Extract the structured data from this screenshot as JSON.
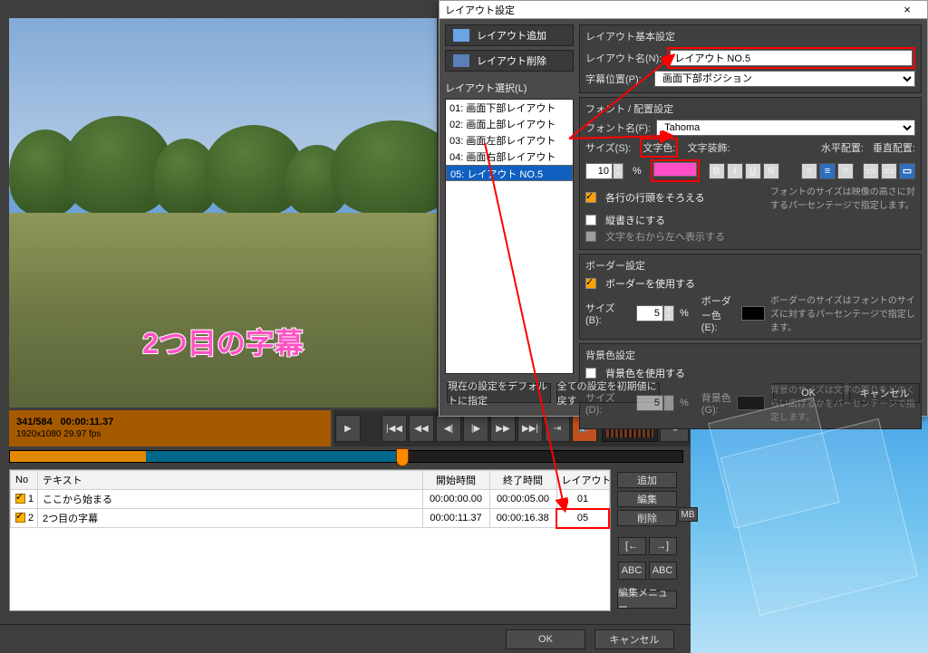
{
  "preview": {
    "subtitle_text": "2つ目の字幕"
  },
  "counter": {
    "frames": "341/584",
    "timecode": "00:00:11.37",
    "meta": "1920x1080 29.97 fps"
  },
  "transport": {
    "play": "▶",
    "prev2": "|◀◀",
    "prev1": "◀◀",
    "step_back": "◀|",
    "step_fwd": "|▶",
    "next1": "▶▶",
    "next2": "▶▶|",
    "marker": "⇥",
    "sound": "🔊",
    "reload": "⟲"
  },
  "grid": {
    "headers": {
      "no": "No",
      "text": "テキスト",
      "start": "開始時間",
      "end": "終了時間",
      "layout": "レイアウト番号"
    },
    "rows": [
      {
        "no": "1",
        "text": "ここから始まる",
        "start": "00:00:00.00",
        "end": "00:00:05.00",
        "layout": "01"
      },
      {
        "no": "2",
        "text": "2つ目の字幕",
        "start": "00:00:11.37",
        "end": "00:00:16.38",
        "layout": "05"
      }
    ]
  },
  "sidebuttons": {
    "add": "追加",
    "edit": "編集",
    "delete": "削除",
    "jump_in": "[←",
    "jump_out": "→]",
    "abc1": "ABC",
    "abc2": "ABC",
    "menu": "編集メニュー"
  },
  "footer": {
    "ok": "OK",
    "cancel": "キャンセル"
  },
  "mb": "MB",
  "dialog": {
    "title": "レイアウト設定",
    "close": "×",
    "left": {
      "add": "レイアウト追加",
      "del": "レイアウト削除",
      "listlabel": "レイアウト選択(L)",
      "items": [
        "01: 画面下部レイアウト",
        "02: 画面上部レイアウト",
        "03: 画面左部レイアウト",
        "04: 画面右部レイアウト",
        "05: レイアウト NO.5"
      ],
      "selected_index": 4
    },
    "basic": {
      "header": "レイアウト基本設定",
      "name_label": "レイアウト名(N):",
      "name_value": "レイアウト NO.5",
      "pos_label": "字幕位置(P):",
      "pos_value": "画面下部ポジション"
    },
    "font": {
      "header": "フォント / 配置設定",
      "fontname_label": "フォント名(F):",
      "fontname_value": "Tahoma",
      "size_label": "サイズ(S):",
      "size_value": "10",
      "size_unit": "%",
      "color_label": "文字色:",
      "color_value": "#ff4fc8",
      "deco_label": "文字装飾:",
      "halign_label": "水平配置:",
      "valign_label": "垂直配置:",
      "bold": "B",
      "italic": "I",
      "underline": "U",
      "strike": "S",
      "chk_line": "各行の行頭をそろえる",
      "chk_vert": "縦書きにする",
      "chk_rtl": "文字を右から左へ表示する",
      "hint": "フォントのサイズは映像の高さに対するパーセンテージで指定します。"
    },
    "border": {
      "header": "ボーダー設定",
      "use": "ボーダーを使用する",
      "size_label": "サイズ(B):",
      "size_value": "5",
      "unit": "%",
      "color_label": "ボーダー色(E):",
      "color_value": "#000000",
      "hint": "ボーダーのサイズはフォントのサイズに対するパーセンテージで指定します。"
    },
    "bg": {
      "header": "背景色設定",
      "use": "背景色を使用する",
      "size_label": "サイズ(D):",
      "size_value": "5",
      "unit": "%",
      "color_label": "背景色(G):",
      "color_value": "#000000",
      "hint": "背景のサイズは文字の周りをどのくらい広げるかをパーセンテージで指定します。"
    },
    "bottom": {
      "setdefault": "現在の設定をデフォルトに指定",
      "reset": "全ての設定を初期値に戻す",
      "ok": "OK",
      "cancel": "キャンセル"
    }
  }
}
